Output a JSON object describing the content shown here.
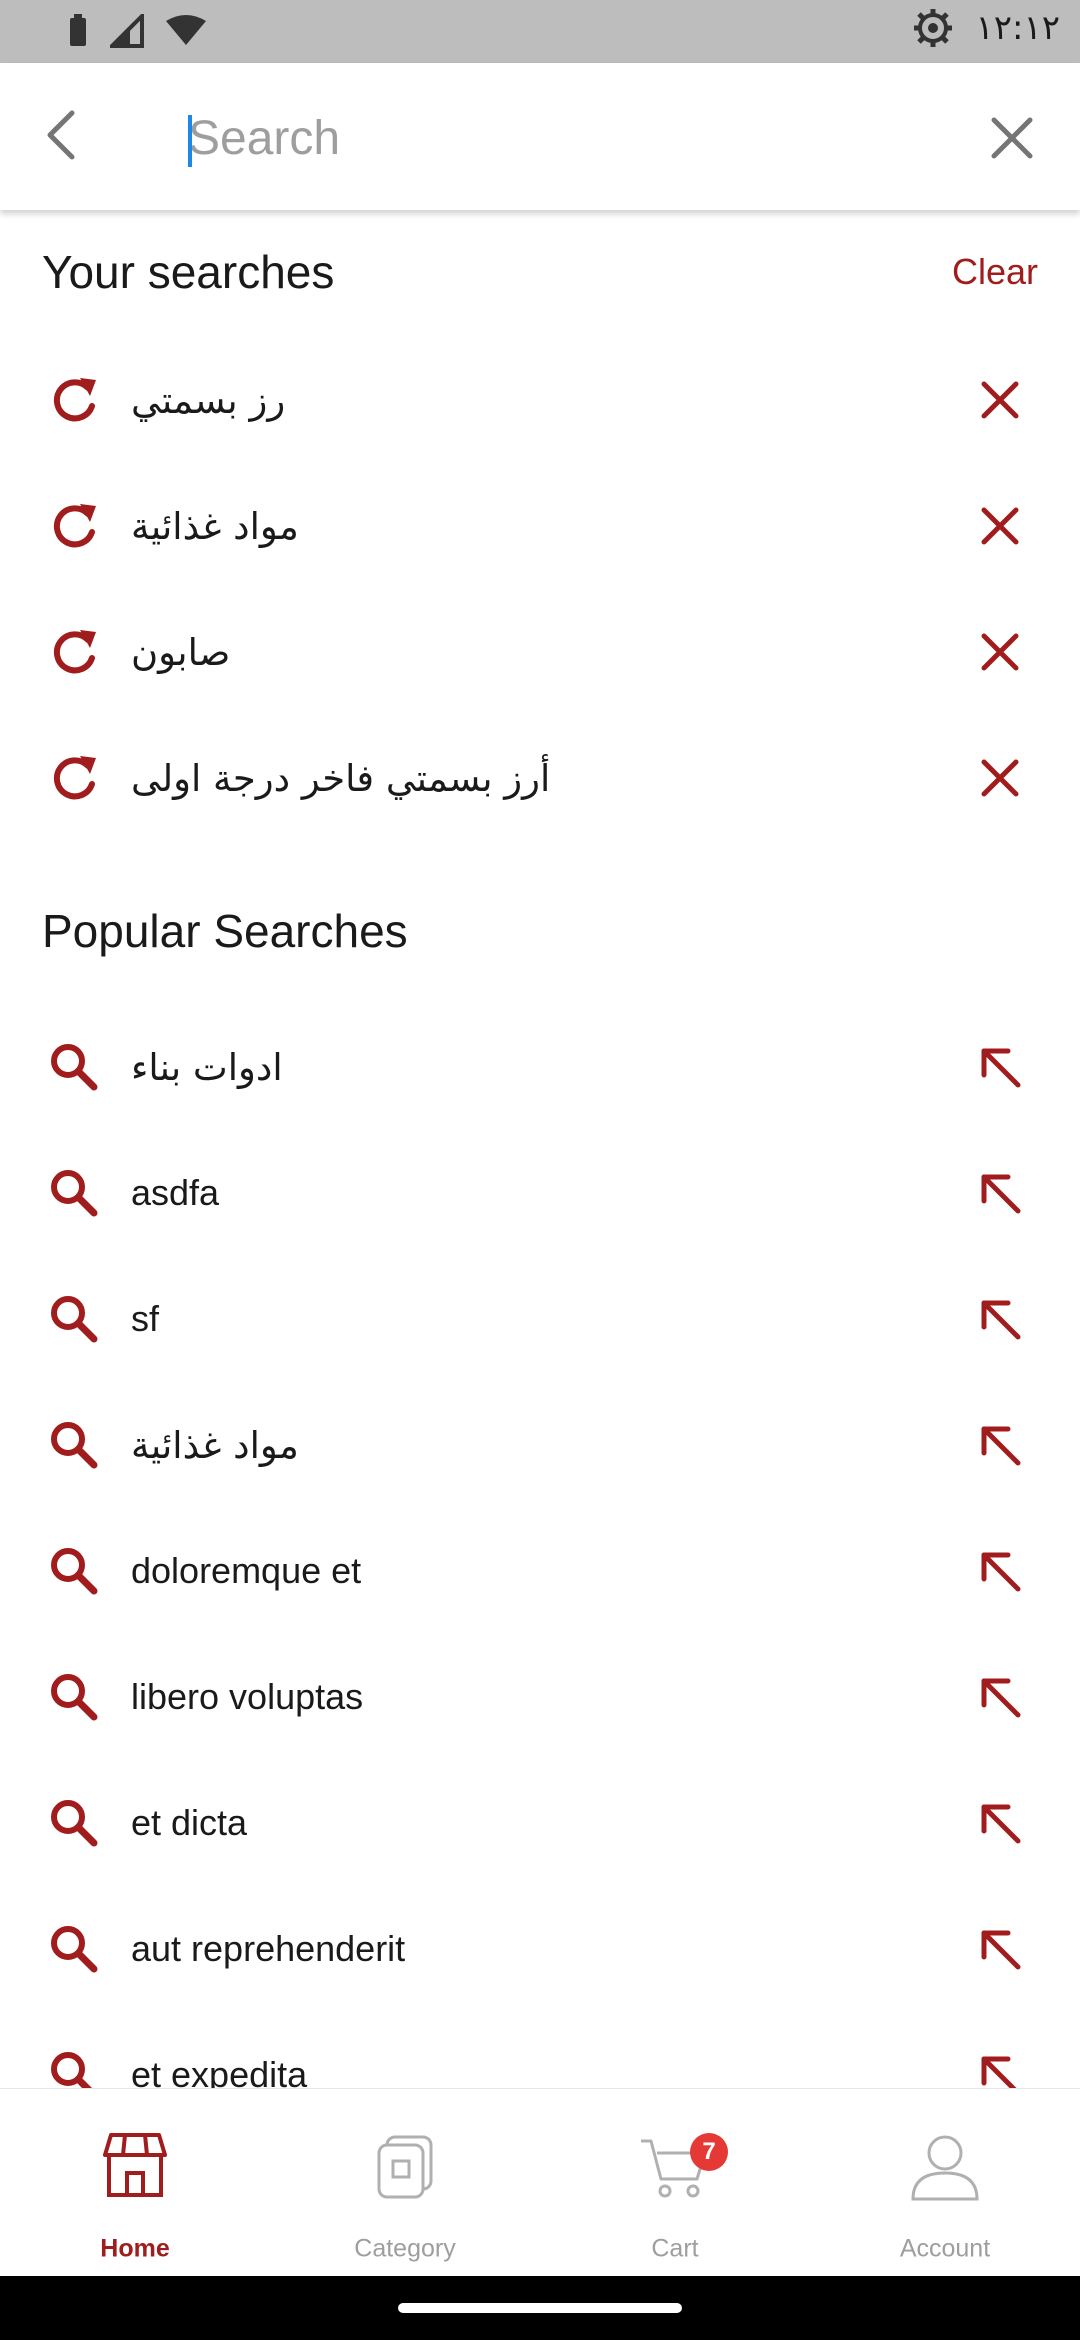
{
  "status_bar": {
    "time": "١٢:١٢"
  },
  "search": {
    "placeholder": "Search",
    "value": ""
  },
  "recent": {
    "title": "Your searches",
    "clear_label": "Clear",
    "items": [
      {
        "label": "رز بسمتي"
      },
      {
        "label": "مواد غذائية"
      },
      {
        "label": "صابون"
      },
      {
        "label": "أرز بسمتي فاخر درجة اولى"
      }
    ]
  },
  "popular": {
    "title": "Popular Searches",
    "items": [
      {
        "label": "ادوات بناء"
      },
      {
        "label": "asdfa"
      },
      {
        "label": "sf"
      },
      {
        "label": "مواد غذائية"
      },
      {
        "label": "doloremque et"
      },
      {
        "label": "libero voluptas"
      },
      {
        "label": "et dicta"
      },
      {
        "label": "aut reprehenderit"
      },
      {
        "label": "et expedita"
      }
    ]
  },
  "nav": {
    "items": [
      {
        "label": "Home",
        "icon": "store-icon",
        "active": true
      },
      {
        "label": "Category",
        "icon": "category-icon",
        "active": false
      },
      {
        "label": "Cart",
        "icon": "cart-icon",
        "active": false,
        "badge": "7"
      },
      {
        "label": "Account",
        "icon": "account-icon",
        "active": false
      }
    ]
  },
  "colors": {
    "accent": "#a11d1d",
    "muted": "#9e9e9e",
    "badge": "#e53935"
  }
}
